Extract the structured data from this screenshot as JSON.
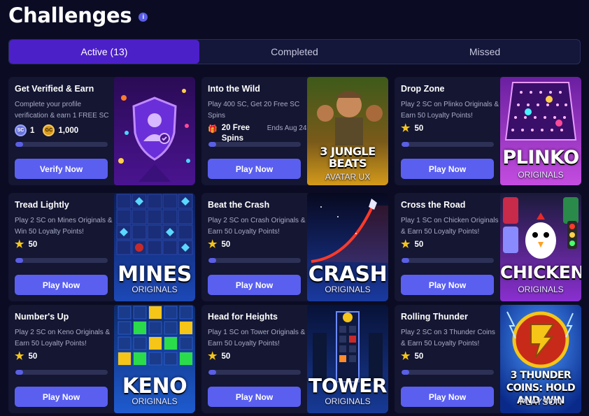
{
  "page": {
    "title": "Challenges",
    "info_icon": "info-icon"
  },
  "tabs": [
    {
      "label": "Active (13)",
      "active": true
    },
    {
      "label": "Completed",
      "active": false
    },
    {
      "label": "Missed",
      "active": false
    }
  ],
  "cards": [
    {
      "title": "Get Verified & Earn",
      "desc": "Complete your profile verification & earn 1 FREE SC",
      "sc_amount": "1",
      "gc_amount": "1,000",
      "coin_sc_label": "SC",
      "coin_gc_label": "GC",
      "progress": 0.08,
      "button": "Verify Now",
      "art_title": "",
      "art_sub": "",
      "art_colors": [
        "#2a0b55",
        "#6b1fb8"
      ]
    },
    {
      "title": "Into the Wild",
      "desc": "Play 400 SC, Get 20 Free SC Spins",
      "extra_reward": "20 Free Spins",
      "ends": "Ends Aug 24",
      "progress": 0.08,
      "button": "Play Now",
      "art_title": "3 JUNGLE BEATS",
      "art_sub": "AVATAR UX",
      "art_colors": [
        "#5a3a0e",
        "#d49a1a"
      ]
    },
    {
      "title": "Drop Zone",
      "desc": "Play 2 SC on Plinko Originals & Earn 50 Loyalty Points!",
      "points": "50",
      "progress": 0.08,
      "button": "Play Now",
      "art_title": "PLINKO",
      "art_sub": "ORIGINALS",
      "art_colors": [
        "#7a1fb0",
        "#c44de0"
      ]
    },
    {
      "title": "Tread Lightly",
      "desc": "Play 2 SC on Mines Originals & Win 50 Loyalty Points!",
      "points": "50",
      "progress": 0.08,
      "button": "Play Now",
      "art_title": "MINES",
      "art_sub": "ORIGINALS",
      "art_colors": [
        "#0d1d55",
        "#1c49b8"
      ]
    },
    {
      "title": "Beat the Crash",
      "desc": "Play 2 SC on Crash Originals & Earn 50 Loyalty Points!",
      "points": "50",
      "progress": 0.08,
      "button": "Play Now",
      "art_title": "CRASH",
      "art_sub": "ORIGINALS",
      "art_colors": [
        "#0a0f3a",
        "#1a3aa0"
      ]
    },
    {
      "title": "Cross the Road",
      "desc": "Play 1 SC on Chicken Originals & Earn 50 Loyalty Points!",
      "points": "50",
      "progress": 0.08,
      "button": "Play Now",
      "art_title": "CHICKEN",
      "art_sub": "ORIGINALS",
      "art_colors": [
        "#3a1a6a",
        "#8a2fd0"
      ]
    },
    {
      "title": "Number's Up",
      "desc": "Play 2 SC on Keno Originals & Earn 50 Loyalty Points!",
      "points": "50",
      "progress": 0.08,
      "button": "Play Now",
      "art_title": "KENO",
      "art_sub": "ORIGINALS",
      "art_colors": [
        "#0d2a6a",
        "#1e5bd0"
      ]
    },
    {
      "title": "Head for Heights",
      "desc": "Play 1 SC on Tower Originals & Earn 50 Loyalty Points!",
      "points": "50",
      "progress": 0.08,
      "button": "Play Now",
      "art_title": "TOWER",
      "art_sub": "ORIGINALS",
      "art_colors": [
        "#081238",
        "#173a96"
      ]
    },
    {
      "title": "Rolling Thunder",
      "desc": "Play 2 SC on 3 Thunder Coins & Earn 50 Loyalty Points!",
      "points": "50",
      "progress": 0.08,
      "button": "Play Now",
      "art_title": "3 THUNDER COINS: HOLD AND WIN",
      "art_sub": "PLAYSON",
      "art_colors": [
        "#0a2a8a",
        "#2a6ae0"
      ]
    }
  ],
  "colors": {
    "accent": "#5a5ff0",
    "active_tab": "#4c20c8",
    "background": "#0b0c24",
    "card": "#141632",
    "star": "#f5c518"
  }
}
